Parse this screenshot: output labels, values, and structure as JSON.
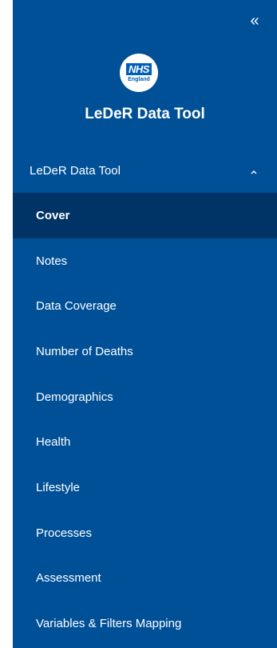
{
  "sidebar": {
    "collapse_glyph": "«",
    "logo": {
      "brand": "NHS",
      "region": "England"
    },
    "title": "LeDeR Data Tool",
    "section": {
      "label": "LeDeR Data Tool",
      "expanded": true
    },
    "items": [
      {
        "label": "Cover",
        "active": true
      },
      {
        "label": "Notes",
        "active": false
      },
      {
        "label": "Data Coverage",
        "active": false
      },
      {
        "label": "Number of Deaths",
        "active": false
      },
      {
        "label": "Demographics",
        "active": false
      },
      {
        "label": "Health",
        "active": false
      },
      {
        "label": "Lifestyle",
        "active": false
      },
      {
        "label": "Processes",
        "active": false
      },
      {
        "label": "Assessment",
        "active": false
      },
      {
        "label": "Variables & Filters Mapping",
        "active": false
      }
    ]
  },
  "colors": {
    "panel_background": "#005097",
    "active_item_background": "#003366",
    "text": "#ffffff",
    "logo_blue": "#005eb8"
  },
  "icons": {
    "collapse": "double-chevron-left-icon",
    "section_toggle": "chevron-up-icon"
  }
}
